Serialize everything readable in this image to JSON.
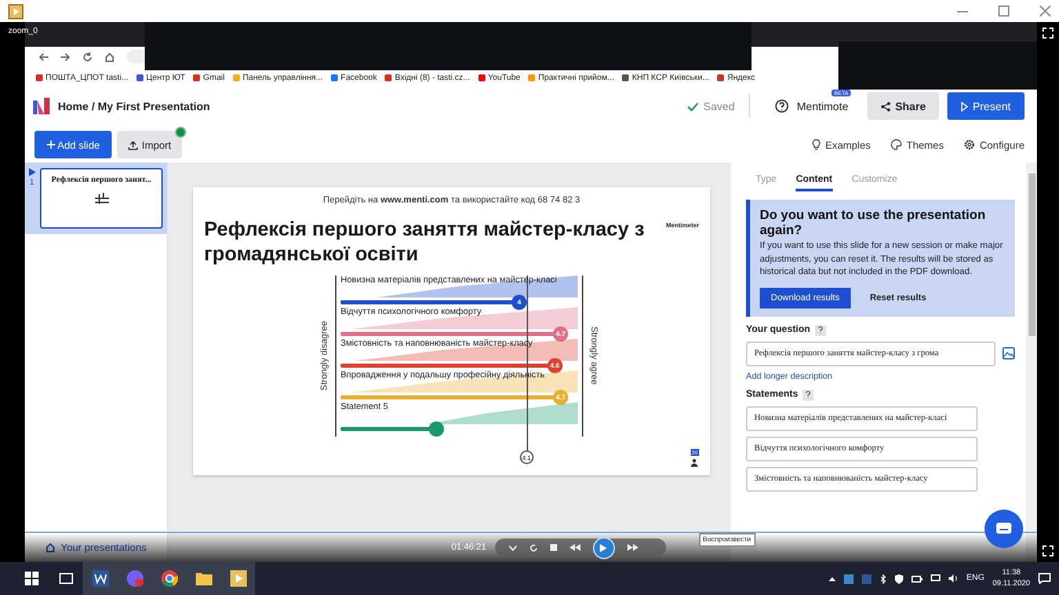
{
  "video_label": "zoom_0",
  "bookmarks": [
    {
      "label": "ПОШТА_ЦПОТ tasti...",
      "color": "#d93025"
    },
    {
      "label": "Центр ЮТ",
      "color": "#3b5bdb"
    },
    {
      "label": "Gmail",
      "color": "#d93025"
    },
    {
      "label": "Панель управління...",
      "color": "#f2b01e"
    },
    {
      "label": "Facebook",
      "color": "#1877f2"
    },
    {
      "label": "Вхідні (8) - tasti.cz...",
      "color": "#d93025"
    },
    {
      "label": "YouTube",
      "color": "#ff0000"
    },
    {
      "label": "Практичні прийом...",
      "color": "#f29900"
    },
    {
      "label": "КНП КСР Київськи...",
      "color": "#555555"
    },
    {
      "label": "Яндекс",
      "color": "#c0392b"
    }
  ],
  "header": {
    "breadcrumb": "Home / My First Presentation",
    "saved": "Saved",
    "mentimote": "Mentimote",
    "beta": "BETA",
    "share": "Share",
    "present": "Present"
  },
  "toolbar": {
    "add_slide": "Add slide",
    "import": "Import",
    "examples": "Examples",
    "themes": "Themes",
    "configure": "Configure"
  },
  "slides": [
    {
      "number": "1",
      "title": "Рефлексія першого занят...",
      "selected": true
    }
  ],
  "home_link": "Your presentations",
  "slide": {
    "instructions": "Перейдіть на **www.menti.com** та використайте код 68 74 82 3",
    "brand": "Mentimeter",
    "title": "Рефлексія першого заняття майстер-класу з громадянської освіти",
    "left_label": "Strongly disagree",
    "right_label": "Strongly agree",
    "average": {
      "reading": "4.1",
      "level": 0.775
    },
    "counter": "20",
    "statements": [
      {
        "label": "Новизна матеріалів представлених на майстер-класі",
        "reading": "4",
        "level": 0.75,
        "color": "#1f4fd1"
      },
      {
        "label": "Відчуття психологічного комфорту",
        "reading": "4.7",
        "level": 0.925,
        "color": "#e0708a"
      },
      {
        "label": "Змістовність та наповнюваність майстер-класу",
        "reading": "4.6",
        "level": 0.9,
        "color": "#e0402f"
      },
      {
        "label": "Впровадження у подальшу професійну діяльність",
        "reading": "4.7",
        "level": 0.925,
        "color": "#e8b030"
      },
      {
        "label": "Statement 5",
        "level": 0.4,
        "color": "#1a9a6a"
      }
    ]
  },
  "panel": {
    "tabs": [
      {
        "label": "Type",
        "selected": false
      },
      {
        "label": "Content",
        "selected": true
      },
      {
        "label": "Customize",
        "selected": false
      }
    ],
    "notice": {
      "title": "Do you want to use the presentation again?",
      "body": "If you want to use this slide for a new session or make major adjustments, you can reset it. The results will be stored as historical data but not included in the PDF download.",
      "primary": "Download results",
      "secondary": "Reset results"
    },
    "question_label": "Your question",
    "question_value": "Рефлексія першого заняття майстер-класу з грома",
    "description_link": "Add longer description",
    "statements_label": "Statements",
    "statements": [
      "Новизна матеріалів представлених на майстер-класі",
      "Відчуття психологічного комфорту",
      "Змістовність та наповнюваність майстер-класу"
    ]
  },
  "player": {
    "time": "01:46:21",
    "tooltip": "Воспроизвести"
  },
  "taskbar": {
    "language": "ENG",
    "time": "11:38",
    "date": "09.11.2020"
  }
}
